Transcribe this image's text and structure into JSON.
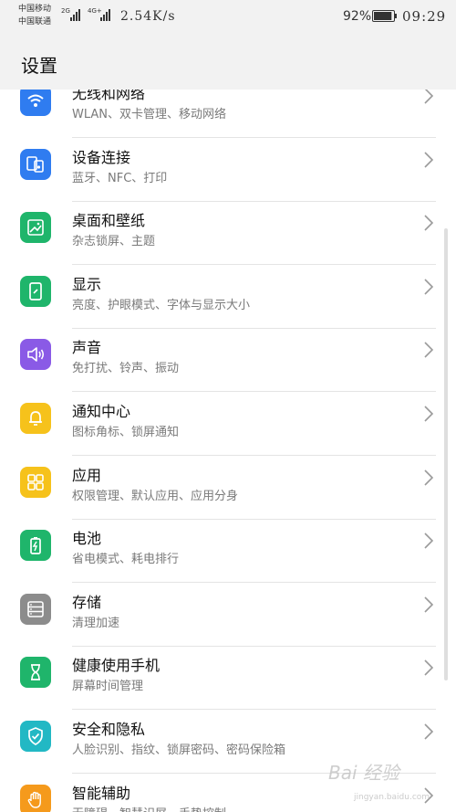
{
  "status_bar": {
    "carrier_1": "中国移动",
    "carrier_2": "中国联通",
    "net_1": "2G",
    "net_2": "4G+",
    "speed": "2.54K/s",
    "battery": "92%",
    "battery_level": 0.92,
    "time": "09:29"
  },
  "header": {
    "title": "设置"
  },
  "colors": {
    "wifi": "#2f7cf0",
    "device": "#2f7cf0",
    "desktop": "#1fb56b",
    "display": "#1fb56b",
    "sound": "#8a5ae6",
    "notify": "#f6c21b",
    "apps": "#f6c21b",
    "battery": "#1fb56b",
    "storage": "#8c8c8c",
    "health": "#1fb56b",
    "security": "#22b8c4",
    "assist": "#f59a1c"
  },
  "items": [
    {
      "id": "wifi",
      "icon": "wifi-icon",
      "title": "无线和网络",
      "sub": "WLAN、双卡管理、移动网络"
    },
    {
      "id": "device",
      "icon": "device-connect-icon",
      "title": "设备连接",
      "sub": "蓝牙、NFC、打印"
    },
    {
      "id": "desktop",
      "icon": "wallpaper-icon",
      "title": "桌面和壁纸",
      "sub": "杂志锁屏、主题"
    },
    {
      "id": "display",
      "icon": "display-icon",
      "title": "显示",
      "sub": "亮度、护眼模式、字体与显示大小"
    },
    {
      "id": "sound",
      "icon": "speaker-icon",
      "title": "声音",
      "sub": "免打扰、铃声、振动"
    },
    {
      "id": "notify",
      "icon": "bell-icon",
      "title": "通知中心",
      "sub": "图标角标、锁屏通知"
    },
    {
      "id": "apps",
      "icon": "apps-grid-icon",
      "title": "应用",
      "sub": "权限管理、默认应用、应用分身"
    },
    {
      "id": "battery",
      "icon": "battery-icon",
      "title": "电池",
      "sub": "省电模式、耗电排行"
    },
    {
      "id": "storage",
      "icon": "storage-icon",
      "title": "存储",
      "sub": "清理加速"
    },
    {
      "id": "health",
      "icon": "hourglass-icon",
      "title": "健康使用手机",
      "sub": "屏幕时间管理"
    },
    {
      "id": "security",
      "icon": "shield-icon",
      "title": "安全和隐私",
      "sub": "人脸识别、指纹、锁屏密码、密码保险箱"
    },
    {
      "id": "assist",
      "icon": "hand-icon",
      "title": "智能辅助",
      "sub": "无障碍、智慧识屏、手势控制"
    }
  ],
  "watermark": {
    "main": "Bai 经验",
    "sub": "jingyan.baidu.com"
  }
}
